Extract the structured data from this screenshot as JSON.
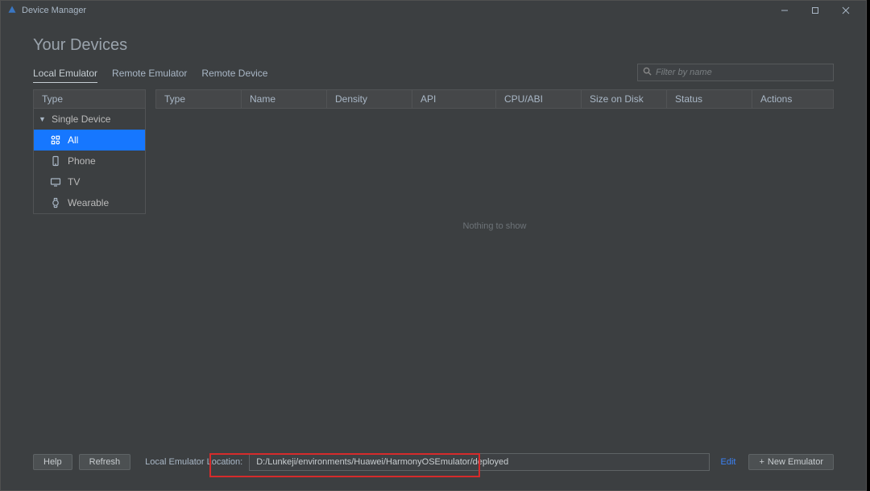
{
  "window": {
    "title": "Device Manager"
  },
  "page": {
    "heading": "Your Devices"
  },
  "tabs": {
    "local": "Local Emulator",
    "remote_emu": "Remote Emulator",
    "remote_dev": "Remote Device"
  },
  "search": {
    "placeholder": "Filter by name"
  },
  "sidebar": {
    "header": "Type",
    "group": "Single Device",
    "items": {
      "all": "All",
      "phone": "Phone",
      "tv": "TV",
      "wearable": "Wearable"
    }
  },
  "table": {
    "headers": {
      "type": "Type",
      "name": "Name",
      "density": "Density",
      "api": "API",
      "cpu": "CPU/ABI",
      "size": "Size on Disk",
      "status": "Status",
      "actions": "Actions"
    },
    "empty": "Nothing to show"
  },
  "footer": {
    "help": "Help",
    "refresh": "Refresh",
    "loc_label": "Local Emulator Location:",
    "loc_value": "D:/Lunkeji/environments/Huawei/HarmonyOSEmulator/deployed",
    "edit": "Edit",
    "new_emu": "New Emulator"
  }
}
